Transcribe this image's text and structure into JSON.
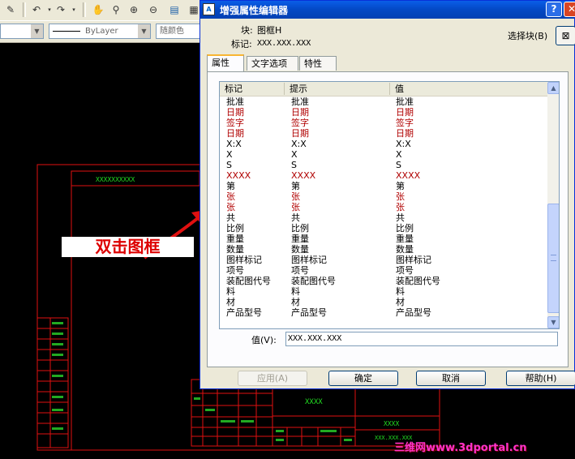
{
  "toolbar": {
    "layer_combo_value": "",
    "linetype_combo_value": "ByLayer",
    "color_combo_value": "随颜色"
  },
  "drawing": {
    "title_cell_text": "XXXXXXXXXX",
    "table_cell_text": "XXXX",
    "code_text_1": "XXXX",
    "code_text_2": "XXX.XXX.XXX",
    "annotation": "双击图框"
  },
  "watermark": "三维网www.3dportal.cn",
  "dialog": {
    "title": "增强属性编辑器",
    "title_icon": "A",
    "help_label": "?",
    "close_label": "✕",
    "block_label": "块:",
    "block_value": "图框H",
    "tag_label": "标记:",
    "tag_value": "XXX.XXX.XXX",
    "select_block_label": "选择块(B)",
    "tabs": [
      {
        "label": "属性",
        "active": true
      },
      {
        "label": "文字选项",
        "active": false
      },
      {
        "label": "特性",
        "active": false
      }
    ],
    "columns": [
      "标记",
      "提示",
      "值"
    ],
    "rows": [
      {
        "tag": "批准",
        "prompt": "批准",
        "value": "批准",
        "red": false
      },
      {
        "tag": "日期",
        "prompt": "日期",
        "value": "日期",
        "red": true
      },
      {
        "tag": "签字",
        "prompt": "签字",
        "value": "签字",
        "red": true
      },
      {
        "tag": "日期",
        "prompt": "日期",
        "value": "日期",
        "red": true
      },
      {
        "tag": "X:X",
        "prompt": "X:X",
        "value": "X:X",
        "red": false
      },
      {
        "tag": "X",
        "prompt": "X",
        "value": "X",
        "red": false
      },
      {
        "tag": "S",
        "prompt": "S",
        "value": "S",
        "red": false
      },
      {
        "tag": "XXXX",
        "prompt": "XXXX",
        "value": "XXXX",
        "red": true
      },
      {
        "tag": "第",
        "prompt": "第",
        "value": "第",
        "red": false
      },
      {
        "tag": "张",
        "prompt": "张",
        "value": "张",
        "red": true
      },
      {
        "tag": "张",
        "prompt": "张",
        "value": "张",
        "red": true
      },
      {
        "tag": "共",
        "prompt": "共",
        "value": "共",
        "red": false
      },
      {
        "tag": "比例",
        "prompt": "比例",
        "value": "比例",
        "red": false
      },
      {
        "tag": "重量",
        "prompt": "重量",
        "value": "重量",
        "red": false
      },
      {
        "tag": "数量",
        "prompt": "数量",
        "value": "数量",
        "red": false
      },
      {
        "tag": "图样标记",
        "prompt": "图样标记",
        "value": "图样标记",
        "red": false
      },
      {
        "tag": "项号",
        "prompt": "项号",
        "value": "项号",
        "red": false
      },
      {
        "tag": "装配图代号",
        "prompt": "装配图代号",
        "value": "装配图代号",
        "red": false
      },
      {
        "tag": "料",
        "prompt": "料",
        "value": "料",
        "red": false
      },
      {
        "tag": "材",
        "prompt": "材",
        "value": "材",
        "red": false
      },
      {
        "tag": "产品型号",
        "prompt": "产品型号",
        "value": "产品型号",
        "red": false
      }
    ],
    "value_label": "值(V):",
    "value_input": "XXX.XXX.XXX",
    "buttons": {
      "apply": "应用(A)",
      "ok": "确定",
      "cancel": "取消",
      "help": "帮助(H)"
    }
  }
}
